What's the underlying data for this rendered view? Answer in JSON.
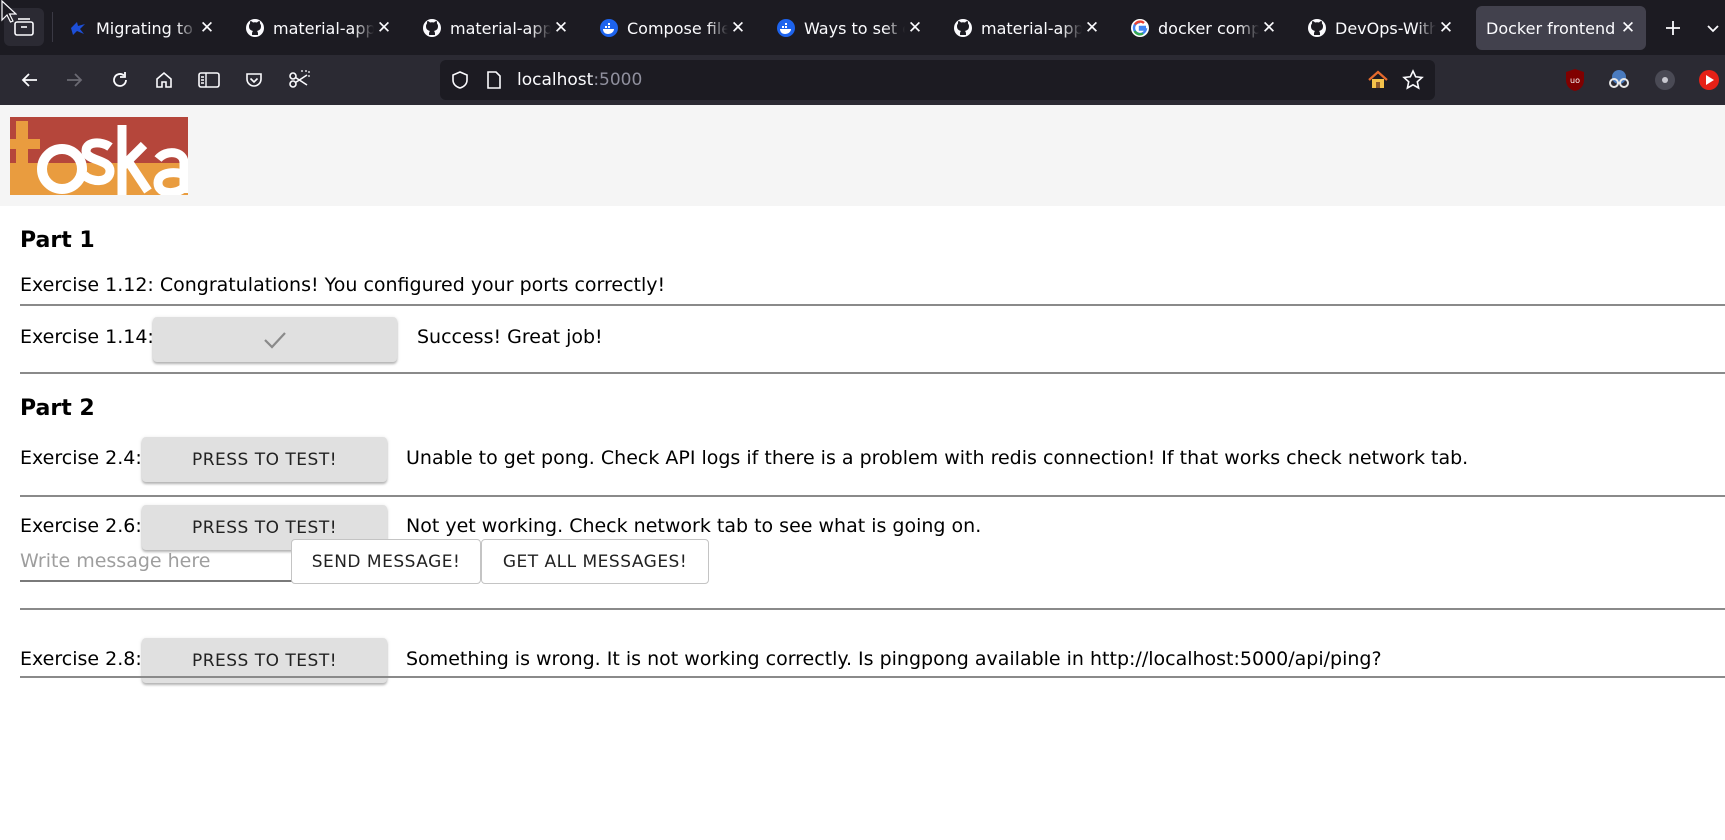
{
  "browser": {
    "tabs": [
      {
        "title": "Migrating to D",
        "favicon": "blue-bird-icon",
        "active": false
      },
      {
        "title": "material-appli",
        "favicon": "github-icon",
        "active": false
      },
      {
        "title": "material-appli",
        "favicon": "github-icon",
        "active": false
      },
      {
        "title": "Compose file v",
        "favicon": "docker-icon",
        "active": false
      },
      {
        "title": "Ways to set en",
        "favicon": "docker-icon",
        "active": false
      },
      {
        "title": "material-appli",
        "favicon": "github-icon",
        "active": false
      },
      {
        "title": "docker compo",
        "favicon": "google-icon",
        "active": false
      },
      {
        "title": "DevOps-With",
        "favicon": "github-icon",
        "active": false
      },
      {
        "title": "Docker frontend",
        "favicon": "none",
        "active": true
      }
    ],
    "url": {
      "host": "localhost",
      "port": ":5000"
    },
    "colors": {
      "tabbar": "#1c1b22",
      "toolbar": "#2b2a33",
      "active_tab": "#42414d"
    }
  },
  "page": {
    "logo_text": "toska",
    "part1": {
      "heading": "Part 1",
      "ex_1_12": "Exercise 1.12: Congratulations! You configured your ports correctly!",
      "ex_1_14_label": "Exercise 1.14:",
      "ex_1_14_button_icon": "checkmark-icon",
      "ex_1_14_status": "Success! Great job!"
    },
    "part2": {
      "heading": "Part 2",
      "ex_2_4_label": "Exercise 2.4:",
      "ex_2_4_button": "PRESS TO TEST!",
      "ex_2_4_status": "Unable to get pong. Check API logs if there is a problem with redis connection! If that works check network tab.",
      "ex_2_6_label": "Exercise 2.6:",
      "ex_2_6_button": "PRESS TO TEST!",
      "ex_2_6_status": "Not yet working. Check network tab to see what is going on.",
      "message_placeholder": "Write message here",
      "send_button": "SEND MESSAGE!",
      "get_button": "GET ALL MESSAGES!",
      "ex_2_8_label": "Exercise 2.8:",
      "ex_2_8_button": "PRESS TO TEST!",
      "ex_2_8_status": "Something is wrong. It is not working correctly. Is pingpong available in http://localhost:5000/api/ping?"
    },
    "colors": {
      "header_bg": "#f5f5f5",
      "logo_red": "#b5463b",
      "logo_orange": "#e99c3f",
      "button_bg": "#e0e0e0"
    }
  }
}
